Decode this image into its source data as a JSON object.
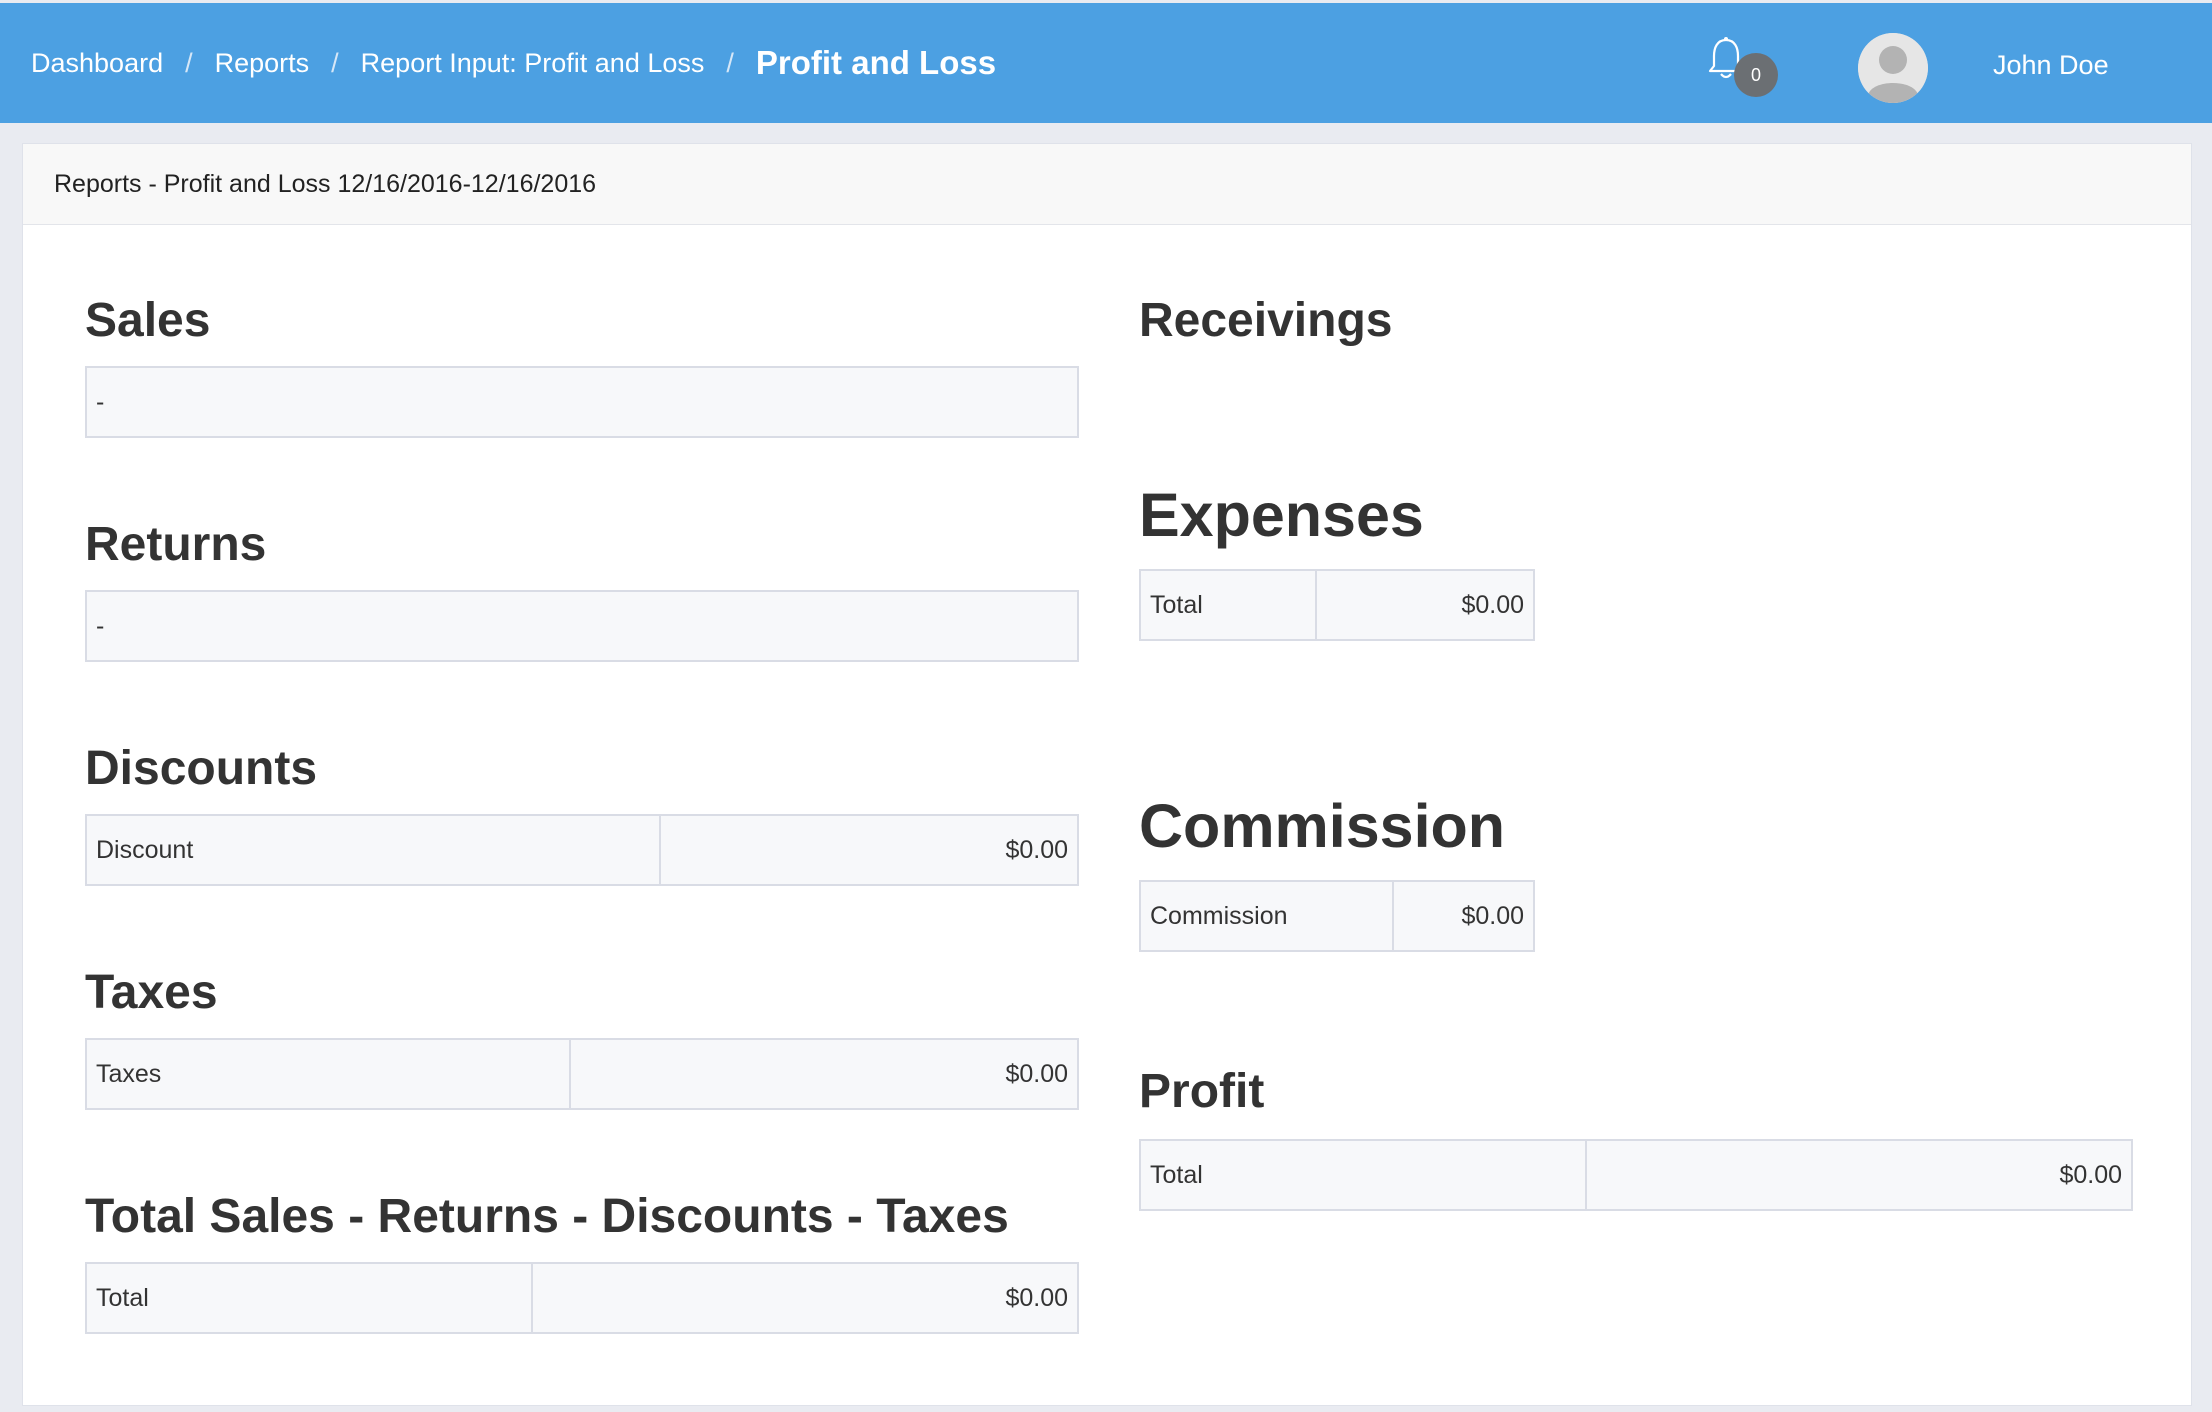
{
  "breadcrumb": {
    "items": [
      "Dashboard",
      "Reports",
      "Report Input: Profit and Loss"
    ],
    "separator": "/",
    "current": "Profit and Loss"
  },
  "header": {
    "notification_count": "0",
    "user_name": "John Doe",
    "bar_color": "#4ca0e2"
  },
  "panel": {
    "heading": "Reports - Profit and Loss 12/16/2016-12/16/2016"
  },
  "sales": {
    "title": "Sales",
    "row_text": "-"
  },
  "returns": {
    "title": "Returns",
    "row_text": "-"
  },
  "discounts": {
    "title": "Discounts",
    "label": "Discount",
    "value": "$0.00"
  },
  "taxes": {
    "title": "Taxes",
    "label": "Taxes",
    "value": "$0.00"
  },
  "total_sales": {
    "title": "Total Sales - Returns - Discounts - Taxes",
    "label": "Total",
    "value": "$0.00"
  },
  "receivings": {
    "title": "Receivings"
  },
  "expenses": {
    "title": "Expenses",
    "label": "Total",
    "value": "$0.00"
  },
  "commission": {
    "title": "Commission",
    "label": "Commission",
    "value": "$0.00"
  },
  "profit": {
    "title": "Profit",
    "label": "Total",
    "value": "$0.00"
  },
  "icons": [
    "bell-icon",
    "avatar-icon"
  ]
}
